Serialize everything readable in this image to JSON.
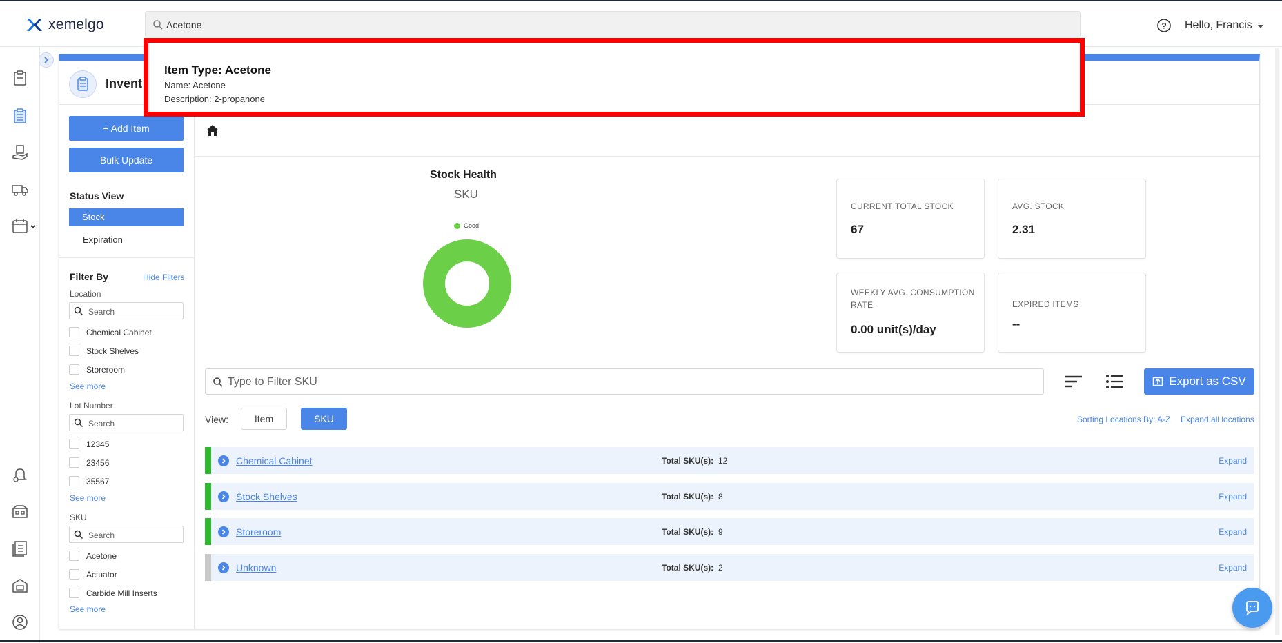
{
  "header": {
    "logo_text": "xemelgo",
    "search_value": "Acetone",
    "greeting": "Hello, Francis"
  },
  "popup": {
    "title": "Item Type: Acetone",
    "name_line": "Name: Acetone",
    "description_line": "Description: 2-propanone"
  },
  "page": {
    "title": "Invent"
  },
  "left_panel": {
    "add_item": "+ Add Item",
    "bulk_update": "Bulk Update",
    "status_view_title": "Status View",
    "status_options": [
      "Stock",
      "Expiration"
    ],
    "filter_by": "Filter By",
    "hide_filters": "Hide Filters",
    "location": {
      "label": "Location",
      "placeholder": "Search",
      "options": [
        "Chemical Cabinet",
        "Stock Shelves",
        "Storeroom"
      ],
      "see_more": "See more"
    },
    "lot_number": {
      "label": "Lot Number",
      "placeholder": "Search",
      "options": [
        "12345",
        "23456",
        "35567"
      ],
      "see_more": "See more"
    },
    "sku": {
      "label": "SKU",
      "placeholder": "Search",
      "options": [
        "Acetone",
        "Actuator",
        "Carbide Mill Inserts"
      ],
      "see_more": "See more"
    }
  },
  "stock_health": {
    "title": "Stock Health",
    "subtitle": "SKU",
    "legend": "Good",
    "good_color": "#6ccf48",
    "good_fraction": 1.0
  },
  "stats": {
    "current_total_stock": {
      "label": "CURRENT TOTAL STOCK",
      "value": "67"
    },
    "avg_stock": {
      "label": "AVG. STOCK",
      "value": "2.31"
    },
    "weekly_avg_consumption": {
      "label_line1": "WEEKLY AVG. CONSUMPTION",
      "label_line2": "RATE",
      "value": "0.00 unit(s)/day"
    },
    "expired_items": {
      "label": "EXPIRED ITEMS",
      "value": "--"
    }
  },
  "toolbar": {
    "filter_placeholder": "Type to Filter SKU",
    "export_label": "Export as CSV",
    "view_label": "View:",
    "view_item": "Item",
    "view_sku": "SKU",
    "sort_label": "Sorting Locations By: A-Z",
    "expand_all": "Expand all locations"
  },
  "locations": [
    {
      "name": "Chemical Cabinet",
      "total_label": "Total SKU(s):",
      "total": "12",
      "expand": "Expand",
      "status_color": "#2db82d"
    },
    {
      "name": "Stock Shelves",
      "total_label": "Total SKU(s):",
      "total": "8",
      "expand": "Expand",
      "status_color": "#2db82d"
    },
    {
      "name": "Storeroom",
      "total_label": "Total SKU(s):",
      "total": "9",
      "expand": "Expand",
      "status_color": "#2db82d"
    },
    {
      "name": "Unknown",
      "total_label": "Total SKU(s):",
      "total": "2",
      "expand": "Expand",
      "status_color": "#c8c8c8"
    }
  ],
  "colors": {
    "accent": "#4a86e8",
    "highlight_border": "#ff0000"
  }
}
